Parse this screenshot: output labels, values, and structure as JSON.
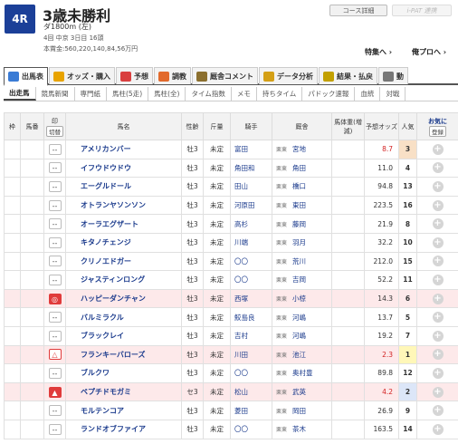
{
  "race": {
    "number": "4R",
    "title": "3歳未勝利",
    "info1": "ダ1800m (左)",
    "info2": "4回 中京 3日目 16頭",
    "info3": "本賞金:560,220,140,84,56万円"
  },
  "header_buttons": {
    "course": "コース詳細",
    "ipat": "i-PAT 連携"
  },
  "links": {
    "special": "特集へ ›",
    "pro": "俺プロへ ›"
  },
  "tabs": [
    "出馬表",
    "オッズ・購入",
    "予想",
    "調教",
    "厩舎コメント",
    "データ分析",
    "結果・払戻",
    "動"
  ],
  "tab_icon_colors": [
    "#3a7bd5",
    "#e8a300",
    "#d94040",
    "#e26a2c",
    "#8b6f2e",
    "#d4a017",
    "#c2a000",
    "#777777"
  ],
  "subnav": [
    "出走馬",
    "競馬新聞",
    "専門紙",
    "馬柱(5走)",
    "馬柱(全)",
    "タイム指数",
    "メモ",
    "持ちタイム",
    "パドック速報",
    "血統",
    "対戦"
  ],
  "columns": {
    "waku": "枠",
    "umaban": "馬番",
    "mark": "印",
    "switch": "切替",
    "name": "馬名",
    "sex_age": "性齢",
    "weight": "斤量",
    "jockey": "騎手",
    "trainer": "厩舎",
    "body": "馬体重(増減)",
    "odds": "予想オッズ",
    "popularity": "人気",
    "fav": "お気に",
    "register": "登録"
  },
  "horses": [
    {
      "mark": "--",
      "mark_style": "",
      "name": "アメリカンバー",
      "sex_age": "牡3",
      "weight": "未定",
      "jockey": "富田",
      "region": "栗東",
      "trainer": "宮地",
      "odds": "8.7",
      "odds_red": true,
      "pop": "3",
      "pop_class": "pop3",
      "hl": false
    },
    {
      "mark": "--",
      "mark_style": "",
      "name": "イフウドウドウ",
      "sex_age": "牡3",
      "weight": "未定",
      "jockey": "角田和",
      "region": "栗東",
      "trainer": "角田",
      "odds": "11.0",
      "odds_red": false,
      "pop": "4",
      "pop_class": "",
      "hl": false
    },
    {
      "mark": "--",
      "mark_style": "",
      "name": "エーグルドール",
      "sex_age": "牡3",
      "weight": "未定",
      "jockey": "田山",
      "region": "栗東",
      "trainer": "橋口",
      "odds": "94.8",
      "odds_red": false,
      "pop": "13",
      "pop_class": "",
      "hl": false
    },
    {
      "mark": "--",
      "mark_style": "",
      "name": "オトランヤソンソン",
      "sex_age": "牡3",
      "weight": "未定",
      "jockey": "河原田",
      "region": "栗東",
      "trainer": "東田",
      "odds": "223.5",
      "odds_red": false,
      "pop": "16",
      "pop_class": "",
      "hl": false
    },
    {
      "mark": "--",
      "mark_style": "",
      "name": "オーラエグザート",
      "sex_age": "牡3",
      "weight": "未定",
      "jockey": "高杉",
      "region": "栗東",
      "trainer": "藤岡",
      "odds": "21.9",
      "odds_red": false,
      "pop": "8",
      "pop_class": "",
      "hl": false
    },
    {
      "mark": "--",
      "mark_style": "",
      "name": "キタノチェンジ",
      "sex_age": "牡3",
      "weight": "未定",
      "jockey": "川端",
      "region": "栗東",
      "trainer": "羽月",
      "odds": "32.2",
      "odds_red": false,
      "pop": "10",
      "pop_class": "",
      "hl": false
    },
    {
      "mark": "--",
      "mark_style": "",
      "name": "クリノエドガー",
      "sex_age": "牡3",
      "weight": "未定",
      "jockey": "〇〇",
      "region": "栗東",
      "trainer": "荒川",
      "odds": "212.0",
      "odds_red": false,
      "pop": "15",
      "pop_class": "",
      "hl": false
    },
    {
      "mark": "--",
      "mark_style": "",
      "name": "ジャスティンロング",
      "sex_age": "牡3",
      "weight": "未定",
      "jockey": "〇〇",
      "region": "栗東",
      "trainer": "吉岡",
      "odds": "52.2",
      "odds_red": false,
      "pop": "11",
      "pop_class": "",
      "hl": false
    },
    {
      "mark": "◎",
      "mark_style": "red",
      "name": "ハッピーダンチャン",
      "sex_age": "牡3",
      "weight": "未定",
      "jockey": "西塚",
      "region": "栗東",
      "trainer": "小椋",
      "odds": "14.3",
      "odds_red": false,
      "pop": "6",
      "pop_class": "",
      "hl": true
    },
    {
      "mark": "--",
      "mark_style": "",
      "name": "バルミラクル",
      "sex_age": "牡3",
      "weight": "未定",
      "jockey": "鮫島良",
      "region": "栗東",
      "trainer": "河嶋",
      "odds": "13.7",
      "odds_red": false,
      "pop": "5",
      "pop_class": "",
      "hl": false
    },
    {
      "mark": "--",
      "mark_style": "",
      "name": "ブラックレイ",
      "sex_age": "牡3",
      "weight": "未定",
      "jockey": "吉村",
      "region": "栗東",
      "trainer": "河嶋",
      "odds": "19.2",
      "odds_red": false,
      "pop": "7",
      "pop_class": "",
      "hl": false
    },
    {
      "mark": "△",
      "mark_style": "redtri",
      "name": "フランキーバローズ",
      "sex_age": "牡3",
      "weight": "未定",
      "jockey": "川田",
      "region": "栗東",
      "trainer": "池江",
      "odds": "2.3",
      "odds_red": true,
      "pop": "1",
      "pop_class": "pop1",
      "hl": true
    },
    {
      "mark": "--",
      "mark_style": "",
      "name": "ブルクワ",
      "sex_age": "牡3",
      "weight": "未定",
      "jockey": "〇〇",
      "region": "栗東",
      "trainer": "奥村豊",
      "odds": "89.8",
      "odds_red": false,
      "pop": "12",
      "pop_class": "",
      "hl": false
    },
    {
      "mark": "▲",
      "mark_style": "red",
      "name": "ペプチドモガミ",
      "sex_age": "セ3",
      "weight": "未定",
      "jockey": "松山",
      "region": "栗東",
      "trainer": "武英",
      "odds": "4.2",
      "odds_red": true,
      "pop": "2",
      "pop_class": "pop2",
      "hl": true
    },
    {
      "mark": "--",
      "mark_style": "",
      "name": "モルテンコア",
      "sex_age": "牡3",
      "weight": "未定",
      "jockey": "菱田",
      "region": "栗東",
      "trainer": "岡田",
      "odds": "26.9",
      "odds_red": false,
      "pop": "9",
      "pop_class": "",
      "hl": false
    },
    {
      "mark": "--",
      "mark_style": "",
      "name": "ランドオブファイア",
      "sex_age": "牡3",
      "weight": "未定",
      "jockey": "〇〇",
      "region": "栗東",
      "trainer": "茶木",
      "odds": "163.5",
      "odds_red": false,
      "pop": "14",
      "pop_class": "",
      "hl": false
    }
  ]
}
